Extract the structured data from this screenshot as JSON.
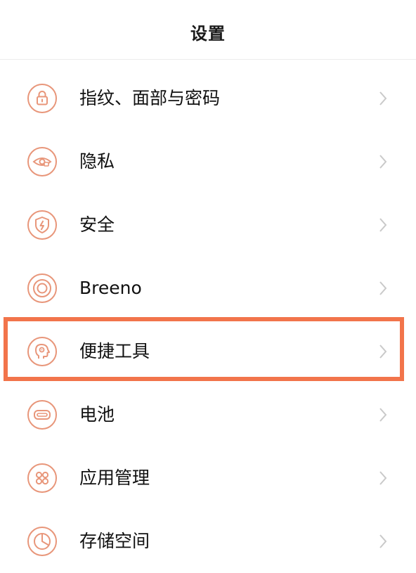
{
  "header": {
    "title": "设置"
  },
  "colors": {
    "icon_accent": "#e8967a",
    "chevron": "#c9c9c9",
    "highlight": "#f2744b"
  },
  "items": [
    {
      "label": "指纹、面部与密码",
      "icon": "lock-icon"
    },
    {
      "label": "隐私",
      "icon": "eye-privacy-icon"
    },
    {
      "label": "安全",
      "icon": "shield-icon"
    },
    {
      "label": "Breeno",
      "icon": "breeno-icon"
    },
    {
      "label": "便捷工具",
      "icon": "head-tools-icon",
      "highlighted": true
    },
    {
      "label": "电池",
      "icon": "battery-icon"
    },
    {
      "label": "应用管理",
      "icon": "apps-grid-icon"
    },
    {
      "label": "存储空间",
      "icon": "storage-pie-icon"
    }
  ]
}
